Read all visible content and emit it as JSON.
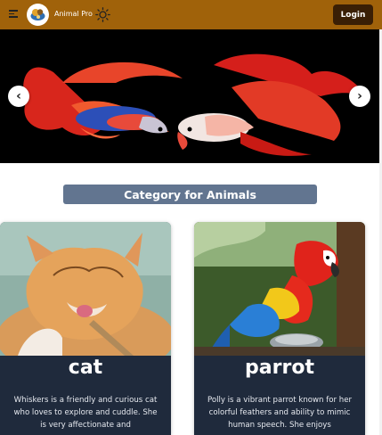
{
  "header": {
    "brand": "Animal Pro",
    "login_label": "Login",
    "icons": {
      "menu": "menu-icon",
      "logo": "logo",
      "theme": "sun-icon"
    }
  },
  "carousel": {
    "prev_label": "‹",
    "next_label": "›"
  },
  "section": {
    "title": "Category for Animals"
  },
  "cards": [
    {
      "title": "cat",
      "text": "Whiskers is a friendly and curious cat who loves to explore and cuddle. She is very affectionate and"
    },
    {
      "title": "parrot",
      "text": "Polly is a vibrant parrot known for her colorful feathers and ability to mimic human speech. She enjoys"
    }
  ],
  "colors": {
    "topbar": "#a0620a",
    "login_bg": "#3a1f05",
    "category_bar": "#627590",
    "card_bg": "#1f2a3c"
  }
}
